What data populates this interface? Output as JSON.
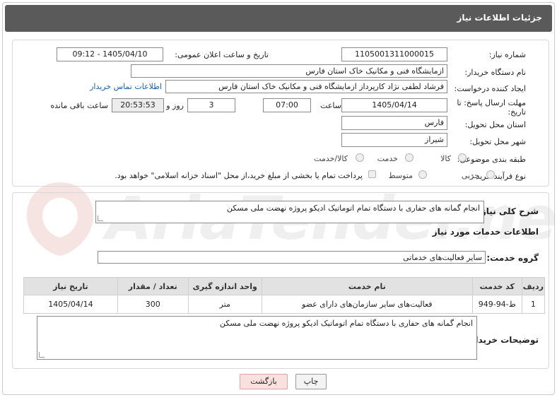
{
  "header": {
    "title": "جزئیات اطلاعات نیاز"
  },
  "fields": {
    "need_number_label": "شماره نیاز:",
    "need_number": "1105001311000015",
    "announce_label": "تاریخ و ساعت اعلان عمومی:",
    "announce_value": "1405/04/10 - 09:12",
    "buyer_org_label": "نام دستگاه خریدار:",
    "buyer_org": "ازمایشگاه فنی و مکانیک خاک استان فارس",
    "requester_label": "ایجاد کننده درخواست:",
    "requester": "فرشاد لطفی نژاد کارپرداز ازمایشگاه فنی و مکانیک خاک استان فارس",
    "contact_link": "اطلاعات تماس خریدار",
    "deadline_label_1": "مهلت ارسال پاسخ: تا",
    "deadline_label_2": "تاریخ:",
    "deadline_date": "1405/04/14",
    "time_label": "ساعت",
    "deadline_time": "07:00",
    "days_value": "3",
    "days_label": "روز و",
    "remaining_time": "20:53:53",
    "remaining_label": "ساعت باقی مانده",
    "province_label": "استان محل تحویل:",
    "province": "فارس",
    "city_label": "شهر محل تحویل:",
    "city": "شیراز",
    "category_label": "طبقه بندی موضوعی:",
    "category_options": [
      "کالا",
      "خدمت",
      "کالا/خدمت"
    ],
    "process_label": "نوع فرآیند خرید :",
    "process_options": [
      "جزیی",
      "متوسط"
    ],
    "payment_note": "پرداخت تمام یا بخشی از مبلغ خرید،از محل \"اسناد خزانه اسلامی\" خواهد بود."
  },
  "summary": {
    "label": "شرح کلی نیاز:",
    "value": "انجام  گمانه های حفاری با دستگاه تمام اتوماتیک ادیکو پروژه نهضت ملی مسکن"
  },
  "services": {
    "section_title": "اطلاعات خدمات مورد نیاز",
    "group_label": "گروه خدمت:",
    "group_value": "سایر فعالیت‌های خدماتی",
    "columns": [
      "ردیف",
      "کد خدمت",
      "نام خدمت",
      "واحد اندازه گیری",
      "تعداد / مقدار",
      "تاریخ نیاز"
    ],
    "rows": [
      [
        "1",
        "ط-94-949",
        "فعالیت‌های سایر سازمان‌های دارای عضو",
        "متر",
        "300",
        "1405/04/14"
      ]
    ]
  },
  "buyer_notes": {
    "label": "توضیحات خریدار:",
    "value": "انجام  گمانه های حفاری با دستگاه تمام اتوماتیک ادیکو پروژه نهضت ملی مسکن"
  },
  "buttons": {
    "print": "چاپ",
    "back": "بازگشت"
  },
  "watermark": {
    "text": "AriaTender.net"
  }
}
